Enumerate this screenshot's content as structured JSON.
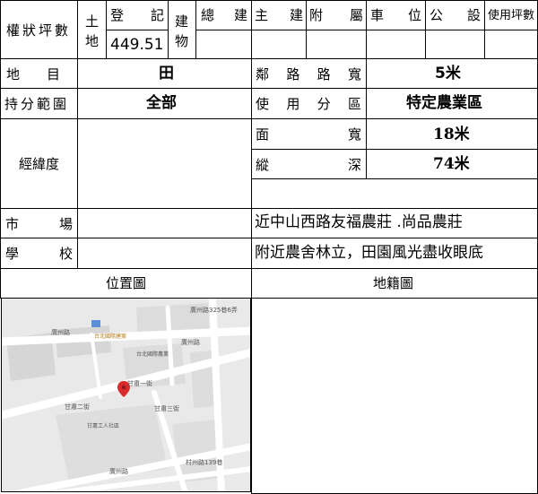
{
  "header": {
    "area_title": "權狀坪數",
    "land_top": "土",
    "land_bottom": "地",
    "register_left": "登",
    "register_right": "記",
    "land_area_value": "449.51",
    "building_top": "建",
    "building_bottom": "物",
    "total_left": "總",
    "total_right": "建",
    "main_left": "主",
    "main_right": "建",
    "annex_left": "附",
    "annex_right": "屬",
    "parking_left": "車",
    "parking_right": "位",
    "common_left": "公",
    "common_right": "設",
    "usage_area": "使用坪數"
  },
  "rows": {
    "land_use_label": "地　　目",
    "land_use_value": "田",
    "ownership_label": "持分範圍",
    "ownership_value": "全部",
    "road_width_label": [
      "鄰",
      "路",
      "路",
      "寬"
    ],
    "road_width_value": "5米",
    "zone_label": [
      "使",
      "用",
      "分",
      "區"
    ],
    "zone_value": "特定農業區",
    "frontage_label": [
      "面",
      "寬"
    ],
    "frontage_value": "18米",
    "depth_label": [
      "縱",
      "深"
    ],
    "depth_value": "74米",
    "coords_label": "經緯度",
    "market_label": [
      "市",
      "場"
    ],
    "market_value": "近中山西路友福農莊 .尚品農莊",
    "school_label": [
      "學",
      "校"
    ],
    "school_value": "附近農舍林立，田園風光盡收眼底",
    "location_map_label": "位置圖",
    "cadastral_map_label": "地籍圖"
  },
  "map": {
    "streets": [
      "廣州路",
      "廣州路325巷6弄",
      "廣州路",
      "甘肅一街",
      "甘肅二街",
      "甘肅三街",
      "村州路139巷",
      "廣州路"
    ],
    "poi_1": "台北國際建案",
    "poi_2": "台北國際農業",
    "poi_3": "甘肅工人社區",
    "road_shield": "□"
  },
  "colors": {
    "border": "#000000",
    "map_bg": "#e9e9e9",
    "map_block": "#d6d6d6",
    "pin": "#d92b2b"
  }
}
